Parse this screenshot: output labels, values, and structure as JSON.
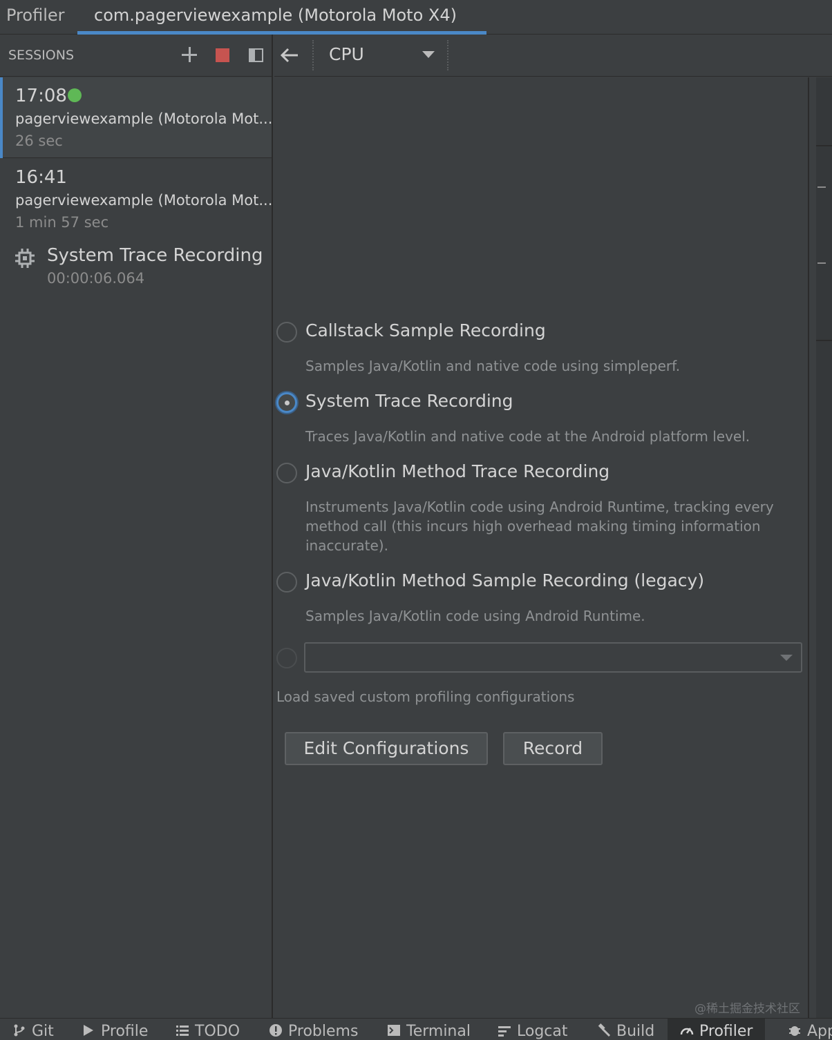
{
  "titlebar": {
    "app_name": "Profiler",
    "tab_label": "com.pagerviewexample (Motorola Moto X4)"
  },
  "sessions": {
    "header_label": "SESSIONS",
    "items": [
      {
        "time": "17:08",
        "name": "pagerviewexample (Motorola Mot...",
        "duration": "26 sec",
        "live": true
      },
      {
        "time": "16:41",
        "name": "pagerviewexample (Motorola Mot...",
        "duration": "1 min 57 sec",
        "live": false
      }
    ],
    "trace": {
      "name": "System Trace Recording",
      "elapsed": "00:00:06.064"
    }
  },
  "toolbar": {
    "profiler_select": "CPU"
  },
  "recording_options": [
    {
      "title": "Callstack Sample Recording",
      "description": "Samples Java/Kotlin and native code using simpleperf.",
      "selected": false
    },
    {
      "title": "System Trace Recording",
      "description": "Traces Java/Kotlin and native code at the Android platform level.",
      "selected": true
    },
    {
      "title": "Java/Kotlin Method Trace Recording",
      "description": "Instruments Java/Kotlin code using Android Runtime, tracking every method call (this incurs high overhead making timing information inaccurate).",
      "selected": false
    },
    {
      "title": "Java/Kotlin Method Sample Recording (legacy)",
      "description": "Samples Java/Kotlin code using Android Runtime.",
      "selected": false
    }
  ],
  "custom": {
    "select_value": "",
    "load_text": "Load saved custom profiling configurations"
  },
  "buttons": {
    "edit_configurations": "Edit Configurations",
    "record": "Record"
  },
  "watermark": "@稀土掘金技术社区",
  "bottom_tools": {
    "git": "Git",
    "profile": "Profile",
    "todo": "TODO",
    "problems": "Problems",
    "terminal": "Terminal",
    "logcat": "Logcat",
    "build": "Build",
    "profiler": "Profiler",
    "app": "App"
  },
  "colors": {
    "accent": "#4a88c7",
    "live_dot": "#5fb856",
    "stop": "#c75450"
  }
}
